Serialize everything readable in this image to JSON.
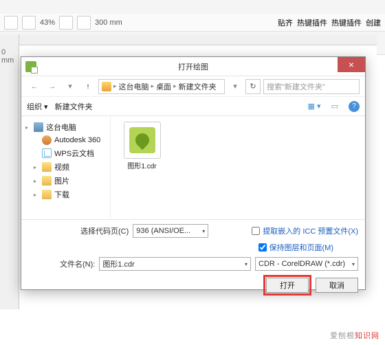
{
  "app_toolbar": {
    "zoom": "43%",
    "unit_mm_top": "300 mm",
    "unit_mm_side": "0 mm",
    "menu_items": [
      "贴齐",
      "热键插件",
      "热键插件",
      "创建"
    ]
  },
  "dialog": {
    "title": "打开绘图",
    "close": "×",
    "nav": {
      "back": "←",
      "forward": "→",
      "up": "↑",
      "dropdown": "▾"
    },
    "breadcrumb": [
      "这台电脑",
      "桌面",
      "新建文件夹"
    ],
    "refresh": "↻",
    "search_placeholder": "搜索\"新建文件夹\"",
    "toolbar": {
      "organize": "组织 ▾",
      "new_folder": "新建文件夹",
      "help": "?"
    },
    "sidebar": [
      {
        "icon": "pc",
        "label": "这台电脑",
        "expandable": true
      },
      {
        "icon": "autodesk",
        "label": "Autodesk 360",
        "indent": true
      },
      {
        "icon": "wps",
        "label": "WPS云文档",
        "indent": true
      },
      {
        "icon": "folder",
        "label": "视频",
        "indent": true,
        "expandable": true
      },
      {
        "icon": "folder",
        "label": "图片",
        "indent": true,
        "expandable": true
      },
      {
        "icon": "folder",
        "label": "下载",
        "indent": true,
        "expandable": true
      }
    ],
    "files": [
      {
        "name": "图形1.cdr",
        "type": "cdr"
      }
    ],
    "codepage_label": "选择代码页(C)",
    "codepage_value": "936  (ANSI/OE...",
    "checkbox_icc": "提取嵌入的 ICC 预置文件(X)",
    "checkbox_icc_checked": false,
    "checkbox_layers": "保持图层和页面(M)",
    "checkbox_layers_checked": true,
    "filename_label": "文件名(N):",
    "filename_value": "图形1.cdr",
    "filetype_value": "CDR - CorelDRAW (*.cdr)",
    "open_btn": "打开",
    "cancel_btn": "取消"
  },
  "watermark": {
    "prefix": "爱刨根",
    "suffix": "知识网"
  }
}
